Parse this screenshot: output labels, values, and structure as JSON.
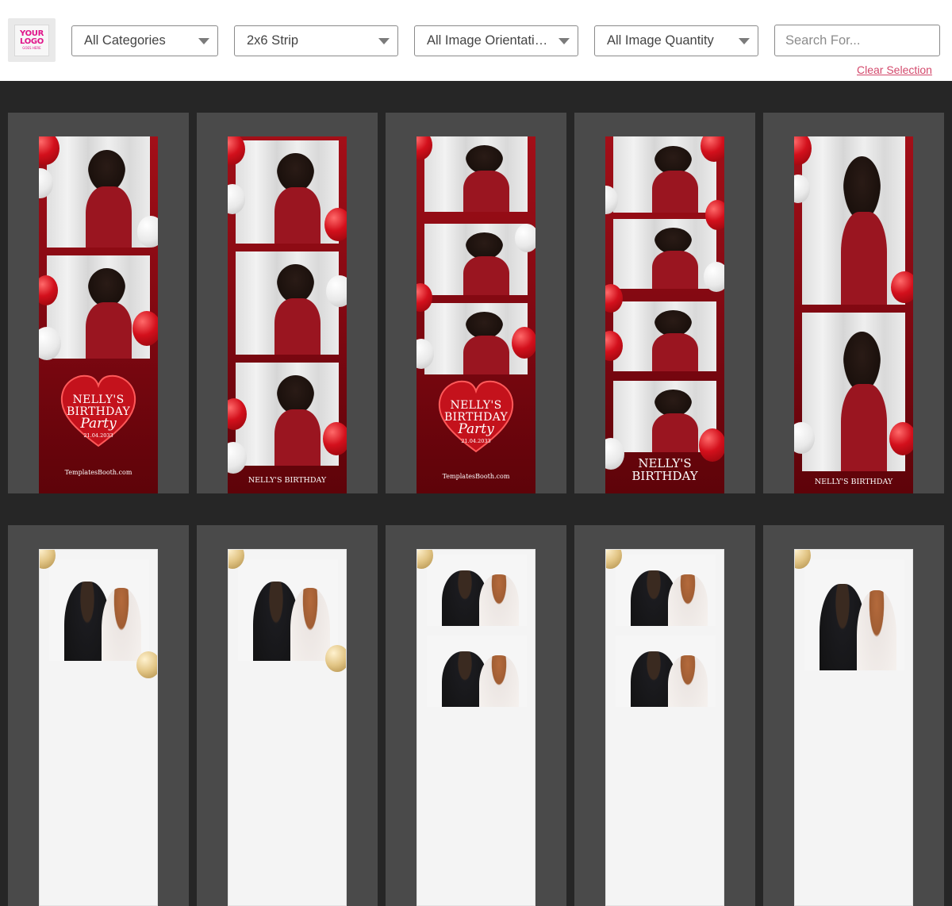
{
  "logo": {
    "line1": "YOUR LOGO",
    "line2": "GOES HERE"
  },
  "filters": {
    "category": "All Categories",
    "format": "2x6 Strip",
    "orientation": "All Image Orientati…",
    "quantity": "All Image Quantity"
  },
  "search": {
    "placeholder": "Search For...",
    "value": ""
  },
  "clear_label": "Clear Selection",
  "templates": {
    "birthday": {
      "title": "NELLY'S BIRTHDAY",
      "script": "Party",
      "date": "21.04.2033",
      "site": "TemplatesBooth.com",
      "footer_small": "NELLY'S BIRTHDAY",
      "footer_big_1": "NELLY'S",
      "footer_big_2": "BIRTHDAY"
    }
  },
  "colors": {
    "accent_link": "#d3496c",
    "logo_pink": "#e0148a",
    "card_bg": "#4a4a4a",
    "page_bg": "#262626"
  }
}
